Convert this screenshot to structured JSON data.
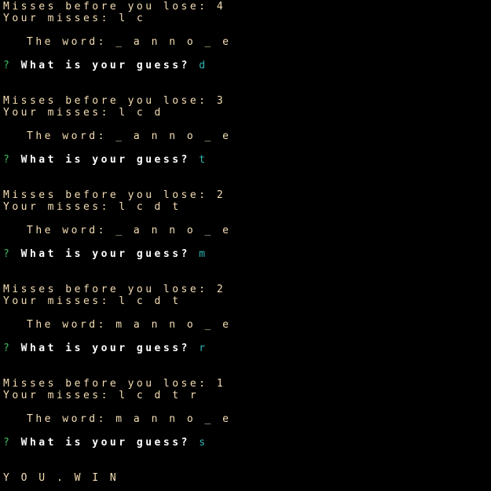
{
  "rounds": [
    {
      "misses_left": "Misses before you lose: 4",
      "your_misses": "Your misses: l c",
      "word": "The word: _ a n n o _ e",
      "prompt_mark": "?",
      "prompt": "What is your guess?",
      "guess": "d"
    },
    {
      "misses_left": "Misses before you lose: 3",
      "your_misses": "Your misses: l c d",
      "word": "The word: _ a n n o _ e",
      "prompt_mark": "?",
      "prompt": "What is your guess?",
      "guess": "t"
    },
    {
      "misses_left": "Misses before you lose: 2",
      "your_misses": "Your misses: l c d t",
      "word": "The word: _ a n n o _ e",
      "prompt_mark": "?",
      "prompt": "What is your guess?",
      "guess": "m"
    },
    {
      "misses_left": "Misses before you lose: 2",
      "your_misses": "Your misses: l c d t",
      "word": "The word: m a n n o _ e",
      "prompt_mark": "?",
      "prompt": "What is your guess?",
      "guess": "r"
    },
    {
      "misses_left": "Misses before you lose: 1",
      "your_misses": "Your misses: l c d t r",
      "word": "The word: m a n n o _ e",
      "prompt_mark": "?",
      "prompt": "What is your guess?",
      "guess": "s"
    }
  ],
  "result": "Y O U . W I N",
  "colors": {
    "background": "#000000",
    "status_text": "#f5deb3",
    "prompt_text": "#ffffff",
    "prompt_mark": "#3fbf5f",
    "guess_text": "#2fb6b6"
  }
}
